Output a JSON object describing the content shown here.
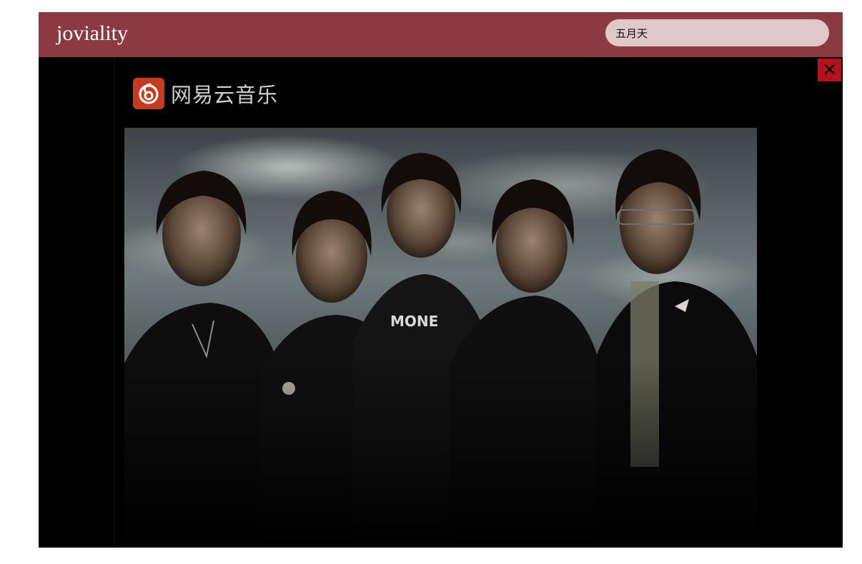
{
  "header": {
    "brand": "joviality",
    "search_value": "五月天",
    "bg_color": "#8a3a40"
  },
  "player": {
    "close_label": "✕",
    "close_icon": "close-icon",
    "watermark_text": "网易云音乐",
    "watermark_logo": "netease-music-logo",
    "close_color": "#b3121e"
  }
}
